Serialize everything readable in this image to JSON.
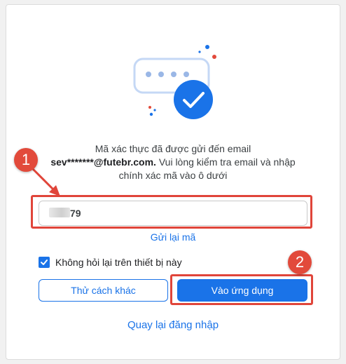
{
  "message": {
    "line1": "Mã xác thực đã được gửi đến email",
    "email": "sev*******@futebr.com.",
    "line2_rest": " Vui lòng kiểm tra email và nhập",
    "line3": "chính xác mã vào ô dưới"
  },
  "otp": {
    "visible_suffix": "79"
  },
  "resend_label": "Gửi lại mã",
  "remember": {
    "label": "Không hỏi lại trên thiết bị này",
    "checked": true
  },
  "buttons": {
    "other_method": "Thử cách khác",
    "enter_app": "Vào ứng dụng"
  },
  "back_to_login": "Quay lại đăng nhập",
  "annotations": {
    "step1": "1",
    "step2": "2"
  },
  "colors": {
    "accent": "#1a73e8",
    "annotation": "#e0453a"
  }
}
